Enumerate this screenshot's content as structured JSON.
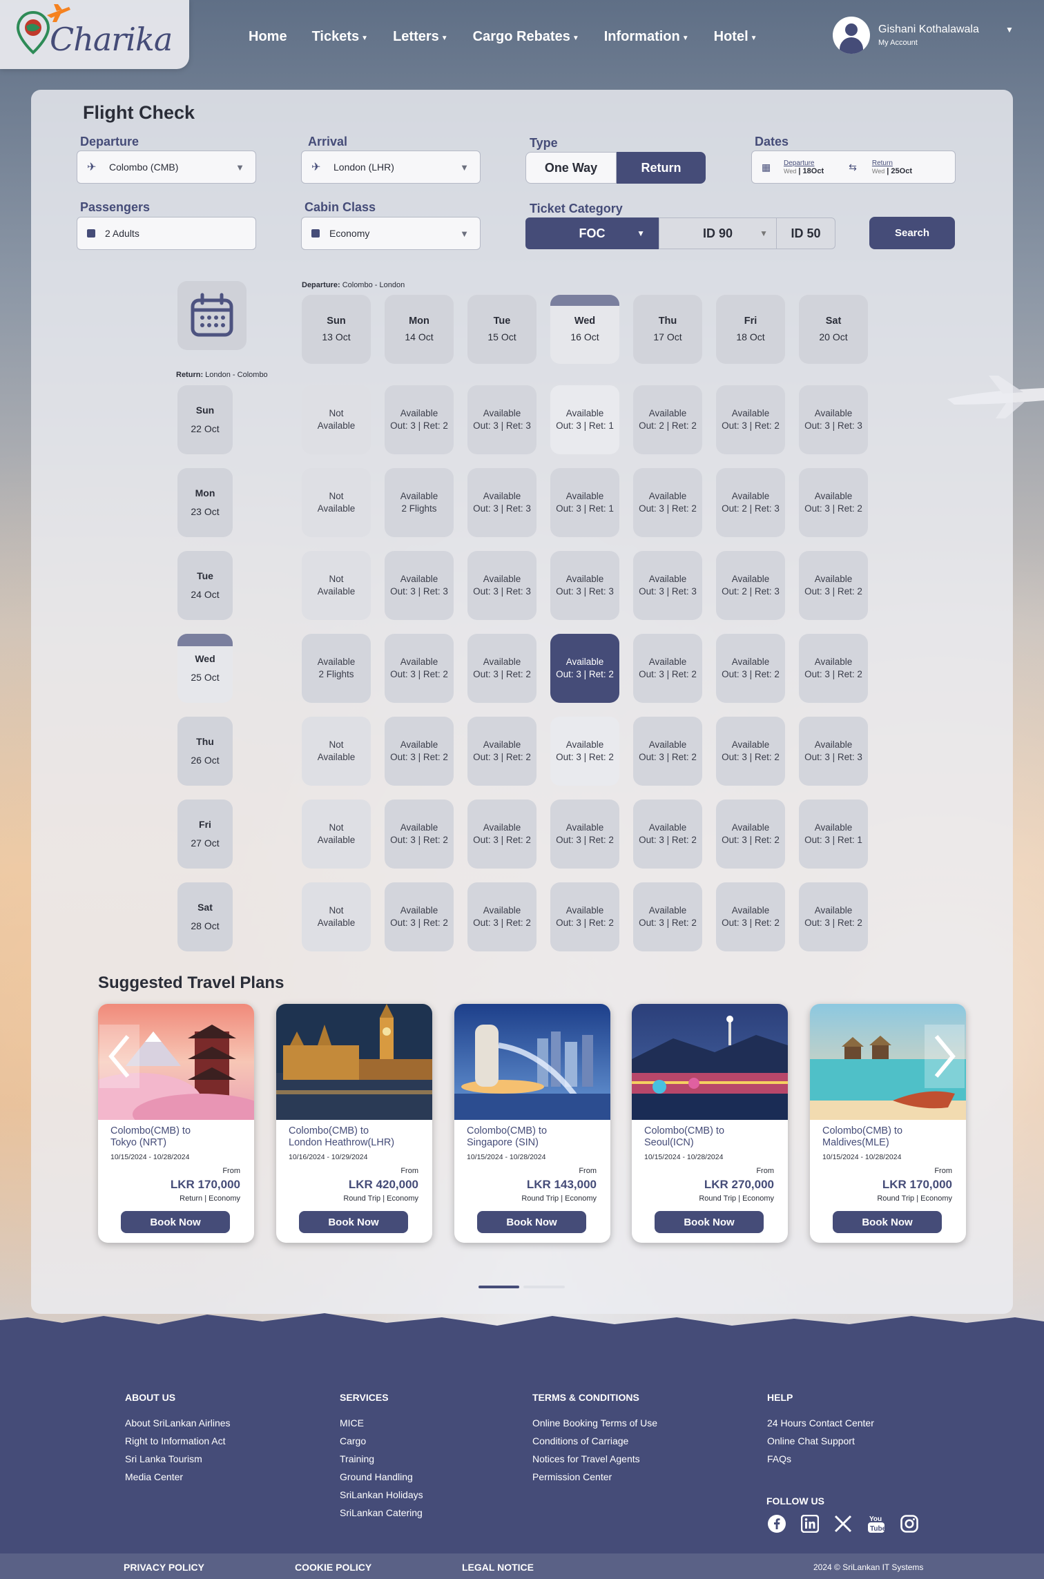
{
  "header": {
    "logo_text": "Charika",
    "nav": [
      {
        "label": "Home",
        "caret": false
      },
      {
        "label": "Tickets",
        "caret": true
      },
      {
        "label": "Letters",
        "caret": true
      },
      {
        "label": "Cargo Rebates",
        "caret": true
      },
      {
        "label": "Information",
        "caret": true
      },
      {
        "label": "Hotel",
        "caret": true
      }
    ],
    "account": {
      "name": "Gishani Kothalawala",
      "subtitle": "My Account"
    }
  },
  "form": {
    "title": "Flight Check",
    "departure": {
      "label": "Departure",
      "value": "Colombo (CMB)"
    },
    "arrival": {
      "label": "Arrival",
      "value": "London (LHR)"
    },
    "type": {
      "label": "Type",
      "options": [
        "One Way",
        "Return"
      ],
      "selected": "Return"
    },
    "dates": {
      "label": "Dates",
      "departure_label": "Departure",
      "departure_weekday": "Wed",
      "departure_value": "18Oct",
      "return_label": "Return",
      "return_weekday": "Wed",
      "return_value": "25Oct"
    },
    "passengers": {
      "label": "Passengers",
      "value": "2 Adults"
    },
    "cabin": {
      "label": "Cabin Class",
      "value": "Economy"
    },
    "ticket_category": {
      "label": "Ticket Category",
      "options": [
        "FOC",
        "ID 90",
        "ID 50"
      ],
      "selected": "FOC"
    },
    "search_label": "Search"
  },
  "calendar": {
    "departure_prefix": "Departure:",
    "departure_route": "Colombo - London",
    "return_prefix": "Return:",
    "return_route": "London - Colombo",
    "dep_days": [
      {
        "day": "Sun",
        "date": "13 Oct"
      },
      {
        "day": "Mon",
        "date": "14 Oct"
      },
      {
        "day": "Tue",
        "date": "15 Oct"
      },
      {
        "day": "Wed",
        "date": "16 Oct",
        "selected": true
      },
      {
        "day": "Thu",
        "date": "17 Oct"
      },
      {
        "day": "Fri",
        "date": "18 Oct"
      },
      {
        "day": "Sat",
        "date": "20 Oct"
      }
    ],
    "ret_days": [
      {
        "day": "Sun",
        "date": "22 Oct"
      },
      {
        "day": "Mon",
        "date": "23 Oct"
      },
      {
        "day": "Tue",
        "date": "24 Oct"
      },
      {
        "day": "Wed",
        "date": "25 Oct",
        "selected": true
      },
      {
        "day": "Thu",
        "date": "26 Oct"
      },
      {
        "day": "Fri",
        "date": "27 Oct"
      },
      {
        "day": "Sat",
        "date": "28 Oct"
      }
    ],
    "rows": [
      [
        [
          "Not",
          "Available"
        ],
        [
          "Available",
          "Out:  3 | Ret: 2"
        ],
        [
          "Available",
          "Out: 3 | Ret: 3"
        ],
        [
          "Available",
          "Out: 3 | Ret: 1"
        ],
        [
          "Available",
          "Out: 2 | Ret: 2"
        ],
        [
          "Available",
          "Out: 3 | Ret: 2"
        ],
        [
          "Available",
          "Out: 3 | Ret: 3"
        ]
      ],
      [
        [
          "Not",
          "Available"
        ],
        [
          "Available",
          "2 Flights"
        ],
        [
          "Available",
          "Out: 3 | Ret: 3"
        ],
        [
          "Available",
          "Out: 3 | Ret: 1"
        ],
        [
          "Available",
          "Out: 3 | Ret: 2"
        ],
        [
          "Available",
          "Out: 2 | Ret: 3"
        ],
        [
          "Available",
          "Out: 3 | Ret: 2"
        ]
      ],
      [
        [
          "Not",
          "Available"
        ],
        [
          "Available",
          "Out: 3 | Ret: 3"
        ],
        [
          "Available",
          "Out: 3 | Ret: 3"
        ],
        [
          "Available",
          "Out: 3 | Ret: 3"
        ],
        [
          "Available",
          "Out: 3 | Ret: 3"
        ],
        [
          "Available",
          "Out: 2 | Ret: 3"
        ],
        [
          "Available",
          "Out: 3 | Ret: 2"
        ]
      ],
      [
        [
          "Available",
          "2 Flights"
        ],
        [
          "Available",
          "Out: 3 | Ret: 2"
        ],
        [
          "Available",
          "Out: 3 | Ret: 2"
        ],
        [
          "Available",
          "Out: 3 | Ret: 2"
        ],
        [
          "Available",
          "Out: 3 | Ret: 2"
        ],
        [
          "Available",
          "Out: 3 | Ret: 2"
        ],
        [
          "Available",
          "Out: 3 | Ret: 2"
        ]
      ],
      [
        [
          "Not",
          "Available"
        ],
        [
          "Available",
          "Out: 3 | Ret: 2"
        ],
        [
          "Available",
          "Out: 3 | Ret: 2"
        ],
        [
          "Available",
          "Out: 3 | Ret: 2"
        ],
        [
          "Available",
          "Out: 3 | Ret: 2"
        ],
        [
          "Available",
          "Out: 3 | Ret: 2"
        ],
        [
          "Available",
          "Out: 3 | Ret: 3"
        ]
      ],
      [
        [
          "Not",
          "Available"
        ],
        [
          "Available",
          "Out: 3 | Ret: 2"
        ],
        [
          "Available",
          "Out: 3 | Ret: 2"
        ],
        [
          "Available",
          "Out: 3 | Ret: 2"
        ],
        [
          "Available",
          "Out: 3 | Ret: 2"
        ],
        [
          "Available",
          "Out: 3 | Ret: 2"
        ],
        [
          "Available",
          "Out: 3 | Ret: 1"
        ]
      ],
      [
        [
          "Not",
          "Available"
        ],
        [
          "Available",
          "Out: 3 | Ret: 2"
        ],
        [
          "Available",
          "Out: 3 | Ret: 2"
        ],
        [
          "Available",
          "Out: 3 | Ret: 2"
        ],
        [
          "Available",
          "Out: 3 | Ret: 2"
        ],
        [
          "Available",
          "Out: 3 | Ret: 2"
        ],
        [
          "Available",
          "Out: 3 | Ret: 2"
        ]
      ]
    ]
  },
  "suggested": {
    "title": "Suggested Travel Plans",
    "from_label": "From",
    "book_label": "Book Now",
    "cards": [
      {
        "route1": "Colombo(CMB) to",
        "route2": "Tokyo (NRT)",
        "dates": "10/15/2024 - 10/28/2024",
        "price": "LKR 170,000",
        "trip": "Return | Economy",
        "theme": "tokyo"
      },
      {
        "route1": "Colombo(CMB) to",
        "route2": "London Heathrow(LHR)",
        "dates": "10/16/2024 - 10/29/2024",
        "price": "LKR 420,000",
        "trip": "Round Trip | Economy",
        "theme": "london"
      },
      {
        "route1": "Colombo(CMB) to",
        "route2": "Singapore (SIN)",
        "dates": "10/15/2024 - 10/28/2024",
        "price": "LKR 143,000",
        "trip": "Round Trip | Economy",
        "theme": "singapore"
      },
      {
        "route1": "Colombo(CMB) to",
        "route2": "Seoul(ICN)",
        "dates": "10/15/2024 - 10/28/2024",
        "price": "LKR 270,000",
        "trip": "Round Trip | Economy",
        "theme": "seoul"
      },
      {
        "route1": "Colombo(CMB) to",
        "route2": "Maldives(MLE)",
        "dates": "10/15/2024 - 10/28/2024",
        "price": "LKR 170,000",
        "trip": "Round Trip | Economy",
        "theme": "maldives"
      }
    ]
  },
  "footer": {
    "columns": [
      {
        "title": "ABOUT US",
        "links": [
          "About SriLankan Airlines",
          "Right to Information Act",
          "Sri Lanka Tourism",
          "Media Center"
        ]
      },
      {
        "title": "SERVICES",
        "links": [
          "MICE",
          "Cargo",
          "Training",
          "Ground Handling",
          "SriLankan Holidays",
          "SriLankan Catering"
        ]
      },
      {
        "title": "TERMS & CONDITIONS",
        "links": [
          "Online Booking Terms of Use",
          "Conditions of Carriage",
          "Notices for Travel Agents",
          "Permission Center"
        ]
      },
      {
        "title": "HELP",
        "links": [
          "24 Hours Contact Center",
          "Online Chat Support",
          "FAQs"
        ]
      }
    ],
    "follow_us": "FOLLOW US",
    "social": [
      "facebook-icon",
      "linkedin-icon",
      "x-icon",
      "youtube-icon",
      "instagram-icon"
    ],
    "bottom_links": [
      "PRIVACY POLICY",
      "COOKIE POLICY",
      "LEGAL NOTICE"
    ],
    "copyright": "2024 © SriLankan IT Systems"
  },
  "colors": {
    "primary": "#454c78",
    "accent": "#f58220",
    "logo_pin": "#2e8b57"
  }
}
